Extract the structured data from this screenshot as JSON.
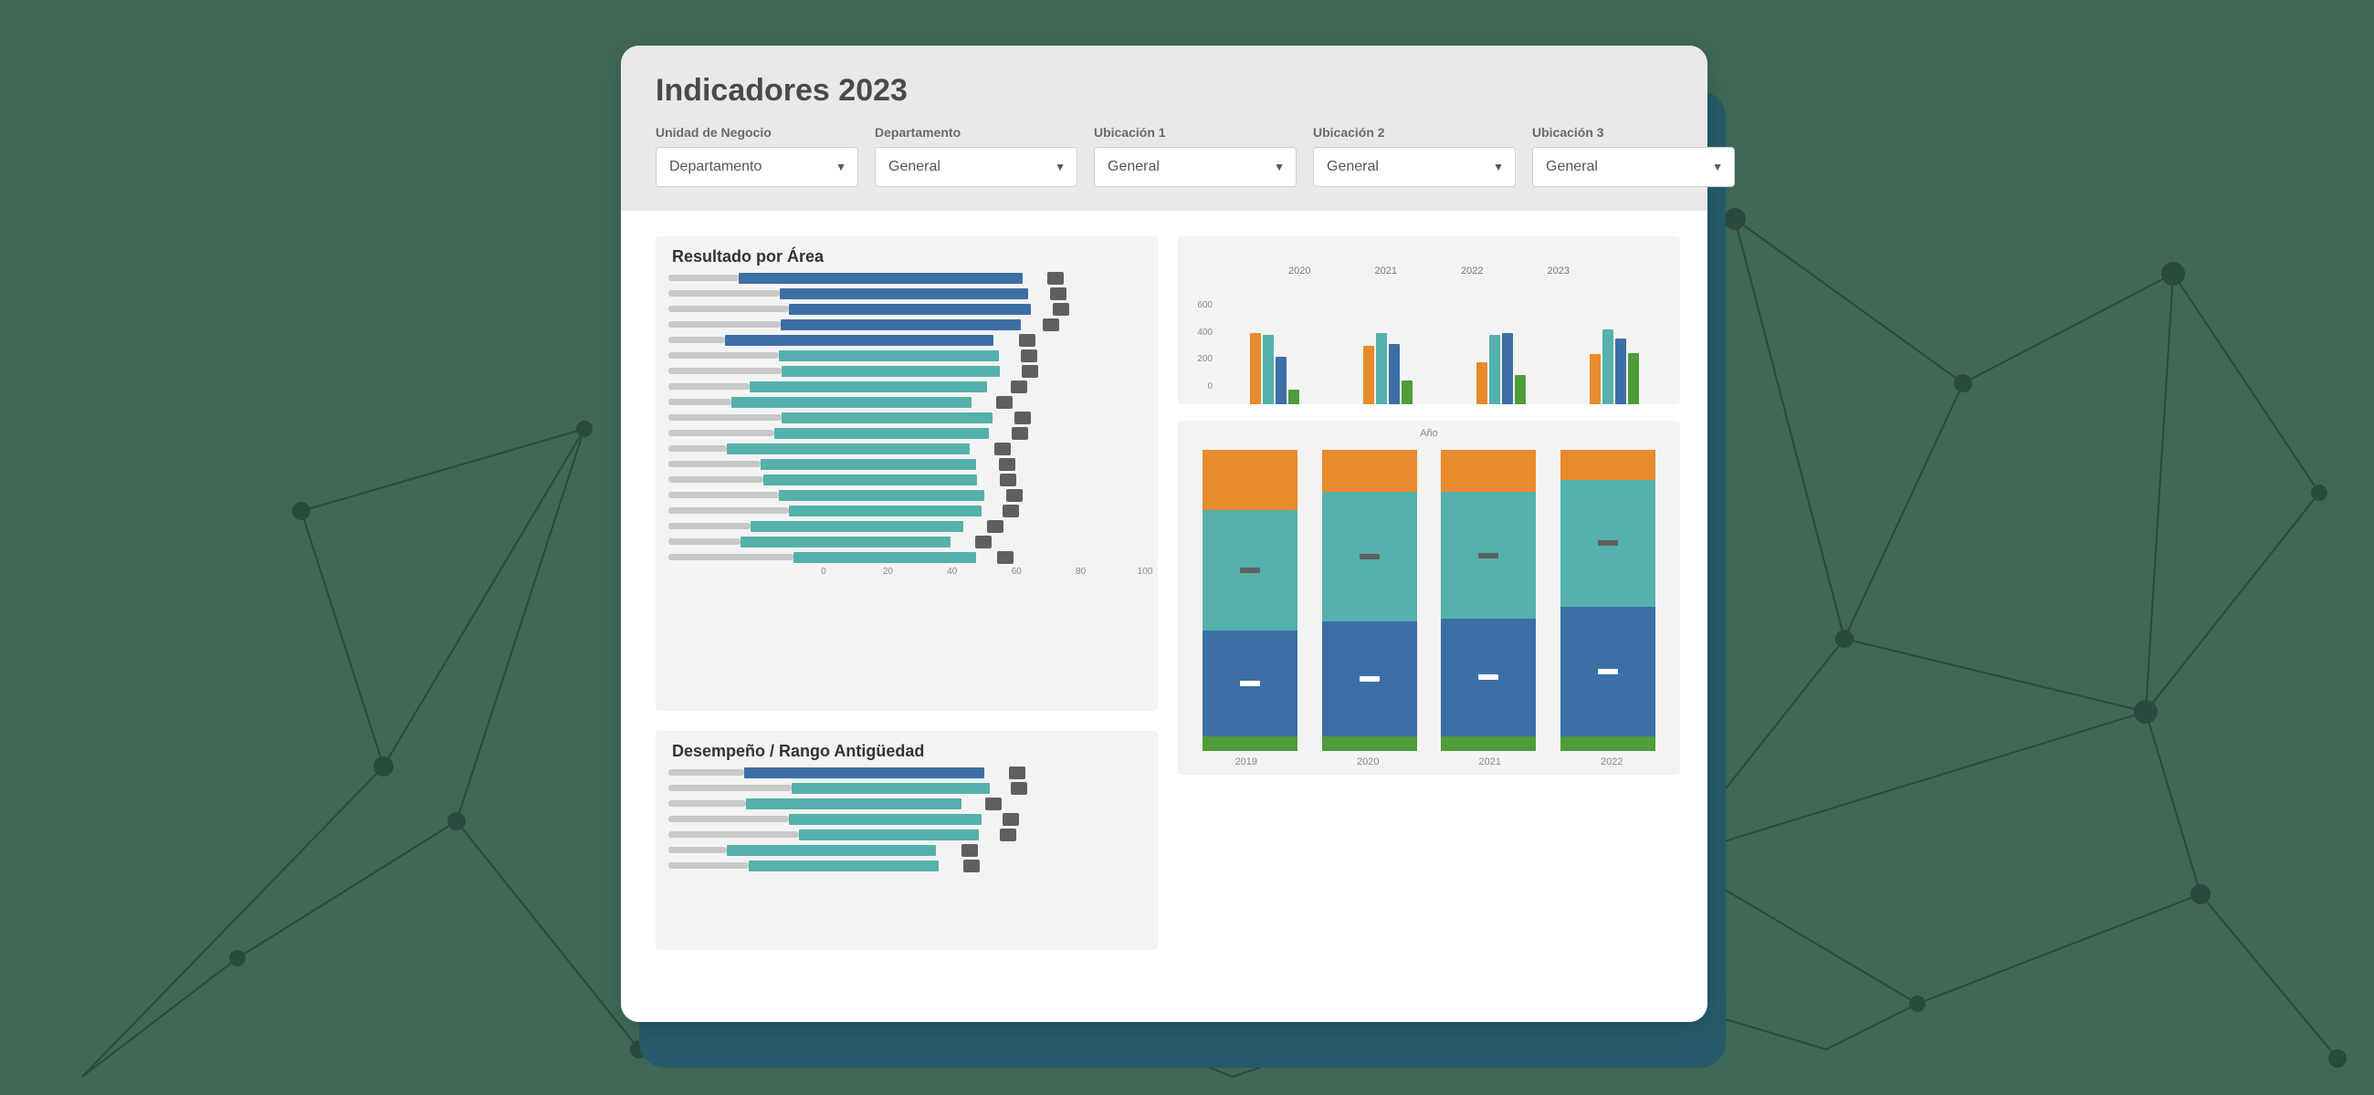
{
  "header": {
    "title": "Indicadores 2023",
    "filters": [
      {
        "label": "Unidad de Negocio",
        "value": "Departamento"
      },
      {
        "label": "Departamento",
        "value": "General"
      },
      {
        "label": "Ubicación 1",
        "value": "General"
      },
      {
        "label": "Ubicación 2",
        "value": "General"
      },
      {
        "label": "Ubicación 3",
        "value": "General"
      }
    ]
  },
  "chart_data": [
    {
      "id": "resultado_por_area",
      "type": "bar",
      "orientation": "horizontal",
      "title": "Resultado por Área",
      "xlabel": "",
      "ylabel": "",
      "xlim": [
        0,
        100
      ],
      "xticks": [
        0,
        20,
        40,
        60,
        80,
        100
      ],
      "series": [
        {
          "name": "grupo-azul",
          "color": "#3c6fa6",
          "values": [
            70,
            68,
            68,
            66,
            64
          ]
        },
        {
          "name": "grupo-teal",
          "color": "#54b1ab",
          "values": [
            60,
            60,
            60,
            58,
            58,
            58,
            58,
            56,
            56,
            56,
            54,
            54,
            52,
            52
          ]
        }
      ],
      "marker_offset": 6
    },
    {
      "id": "grupos_anuales",
      "type": "bar",
      "orientation": "vertical",
      "title": "",
      "legend": [
        "2020",
        "2021",
        "2022",
        "2023"
      ],
      "ylabel": "",
      "ylim": [
        0,
        600
      ],
      "yticks": [
        0,
        200,
        400,
        600
      ],
      "groups": [
        {
          "values": [
            390,
            380,
            260,
            80
          ],
          "colors": [
            "#e78b2c",
            "#54b1ab",
            "#3c6fa6",
            "#4f9c3a"
          ]
        },
        {
          "values": [
            320,
            390,
            330,
            130
          ],
          "colors": [
            "#e78b2c",
            "#54b1ab",
            "#3c6fa6",
            "#4f9c3a"
          ]
        },
        {
          "values": [
            230,
            380,
            390,
            160
          ],
          "colors": [
            "#e78b2c",
            "#54b1ab",
            "#3c6fa6",
            "#4f9c3a"
          ]
        },
        {
          "values": [
            275,
            410,
            360,
            280
          ],
          "colors": [
            "#e78b2c",
            "#54b1ab",
            "#3c6fa6",
            "#4f9c3a"
          ]
        }
      ]
    },
    {
      "id": "composicion_anual",
      "type": "bar_stacked",
      "title": "",
      "axis_title": "Año",
      "categories": [
        "2019",
        "2020",
        "2021",
        "2022"
      ],
      "stack_order": [
        "orange",
        "teal",
        "blue",
        "green"
      ],
      "colors": {
        "orange": "#e78b2c",
        "teal": "#54b1ab",
        "blue": "#3c6fa6",
        "green": "#4f9c3a"
      },
      "series": [
        {
          "orange": 20,
          "teal": 40,
          "blue": 35,
          "green": 5
        },
        {
          "orange": 14,
          "teal": 43,
          "blue": 38,
          "green": 5
        },
        {
          "orange": 14,
          "teal": 42,
          "blue": 39,
          "green": 5
        },
        {
          "orange": 10,
          "teal": 42,
          "blue": 43,
          "green": 5
        }
      ]
    },
    {
      "id": "desempeno_rango_antiguedad",
      "type": "bar",
      "orientation": "horizontal",
      "title": "Desempeño / Rango Antigüedad",
      "xlim": [
        0,
        100
      ],
      "series": [
        {
          "name": "grupo-azul",
          "color": "#3c6fa6",
          "values": [
            60
          ]
        },
        {
          "name": "grupo-teal",
          "color": "#54b1ab",
          "values": [
            56,
            54,
            54,
            52,
            50,
            48
          ]
        }
      ],
      "marker_offset": 6
    }
  ]
}
